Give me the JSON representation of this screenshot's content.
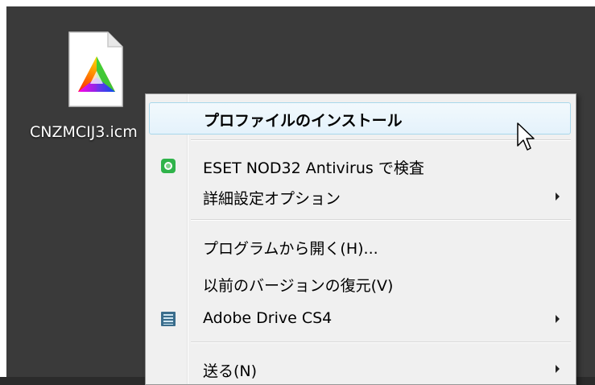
{
  "desktop": {
    "file": {
      "name": "CNZMCIJ3.icm"
    }
  },
  "context_menu": {
    "items": [
      {
        "label": "プロファイルのインストール",
        "bold": true,
        "highlighted": true
      },
      {
        "label": "ESET NOD32 Antivirus で検査",
        "icon": "eset-icon"
      },
      {
        "label": "詳細設定オプション",
        "submenu": true
      },
      {
        "label": "プログラムから開く(H)..."
      },
      {
        "label": "以前のバージョンの復元(V)"
      },
      {
        "label": "Adobe Drive CS4",
        "icon": "adobe-drive-icon",
        "submenu": true
      },
      {
        "label": "送る(N)",
        "submenu": true
      }
    ]
  },
  "colors": {
    "desktop_bg": "#3a3a3a",
    "menu_bg": "#f0f0f0",
    "highlight_border": "#a8d8eb",
    "eset_green": "#2fb34a"
  }
}
